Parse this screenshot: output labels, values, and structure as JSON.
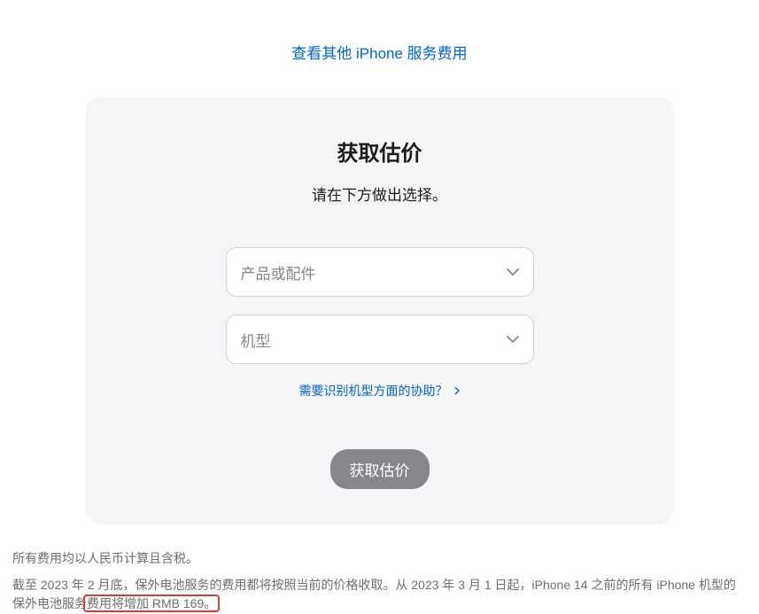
{
  "topLink": "查看其他 iPhone 服务费用",
  "card": {
    "title": "获取估价",
    "subtitle": "请在下方做出选择。",
    "select1": "产品或配件",
    "select2": "机型",
    "help": "需要识别机型方面的协助？",
    "button": "获取估价"
  },
  "footer": {
    "p1": "所有费用均以人民币计算且含税。",
    "p2a": "截至 2023 年 2 月底，保外电池服务的费用都将按照当前的价格收取。从 2023 年 3 月 1 日起，iPhone 14 之前的所有 iPhone 机型的保外电池服务",
    "p2b": "费用将增加 RMB 169。"
  }
}
